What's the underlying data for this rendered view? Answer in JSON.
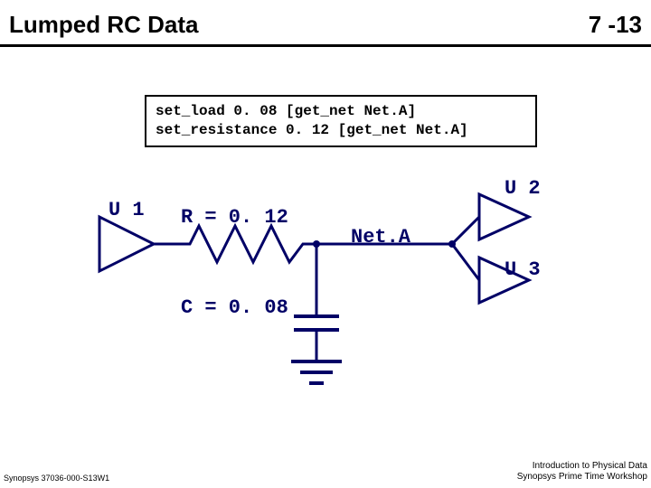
{
  "header": {
    "title": "Lumped RC Data",
    "pagenum": "7 -13"
  },
  "code": {
    "line1": "set_load 0. 08 [get_net Net.A]",
    "line2": "set_resistance 0. 12 [get_net Net.A]"
  },
  "labels": {
    "u1": "U 1",
    "u2": "U 2",
    "u3": "U 3",
    "r": "R = 0. 12",
    "c": "C = 0. 08",
    "net": "Net.A"
  },
  "footer": {
    "left": "Synopsys 37036-000-S13W1",
    "right1": "Introduction to Physical Data",
    "right2": "Synopsys Prime Time Workshop"
  }
}
